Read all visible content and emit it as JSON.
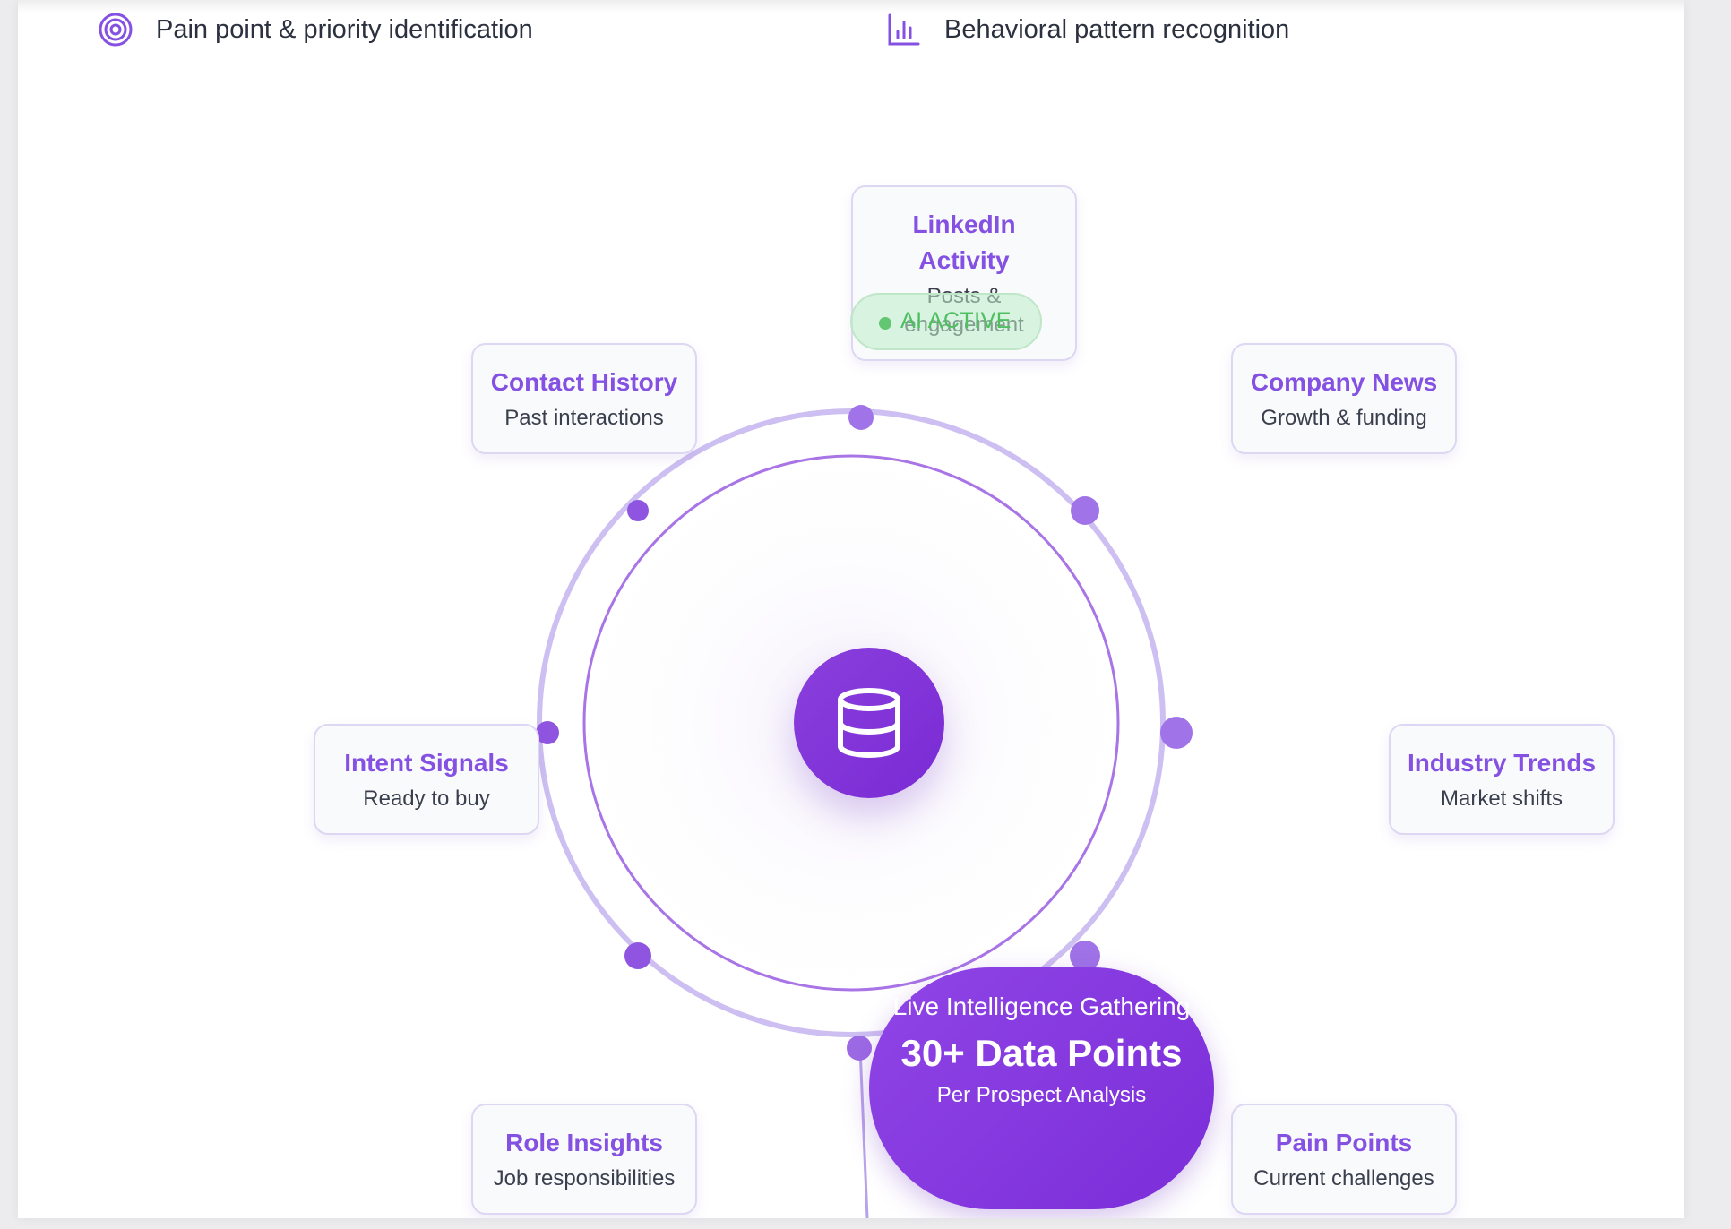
{
  "features": [
    {
      "label": "Pain point & priority identification",
      "icon": "target-icon"
    },
    {
      "label": "Behavioral pattern recognition",
      "icon": "bar-chart-icon"
    }
  ],
  "center": {
    "icon": "database-icon"
  },
  "nodes": {
    "linkedin": {
      "title": "LinkedIn Activity",
      "subtitle": "Posts & engagement"
    },
    "contact": {
      "title": "Contact History",
      "subtitle": "Past interactions"
    },
    "company": {
      "title": "Company News",
      "subtitle": "Growth & funding"
    },
    "intent": {
      "title": "Intent Signals",
      "subtitle": "Ready to buy"
    },
    "industry": {
      "title": "Industry Trends",
      "subtitle": "Market shifts"
    },
    "role": {
      "title": "Role Insights",
      "subtitle": "Job responsibilities"
    },
    "pain": {
      "title": "Pain Points",
      "subtitle": "Current challenges"
    }
  },
  "ai_badge": {
    "label": "AI ACTIVE"
  },
  "live": {
    "heading": "Live Intelligence Gathering",
    "stat": "30+ Data Points",
    "caption": "Per Prospect Analysis"
  },
  "colors": {
    "accent": "#8451e2",
    "ring": "#a874e6",
    "outer_ring": "#cdbff1",
    "active": "#4fbf62"
  }
}
